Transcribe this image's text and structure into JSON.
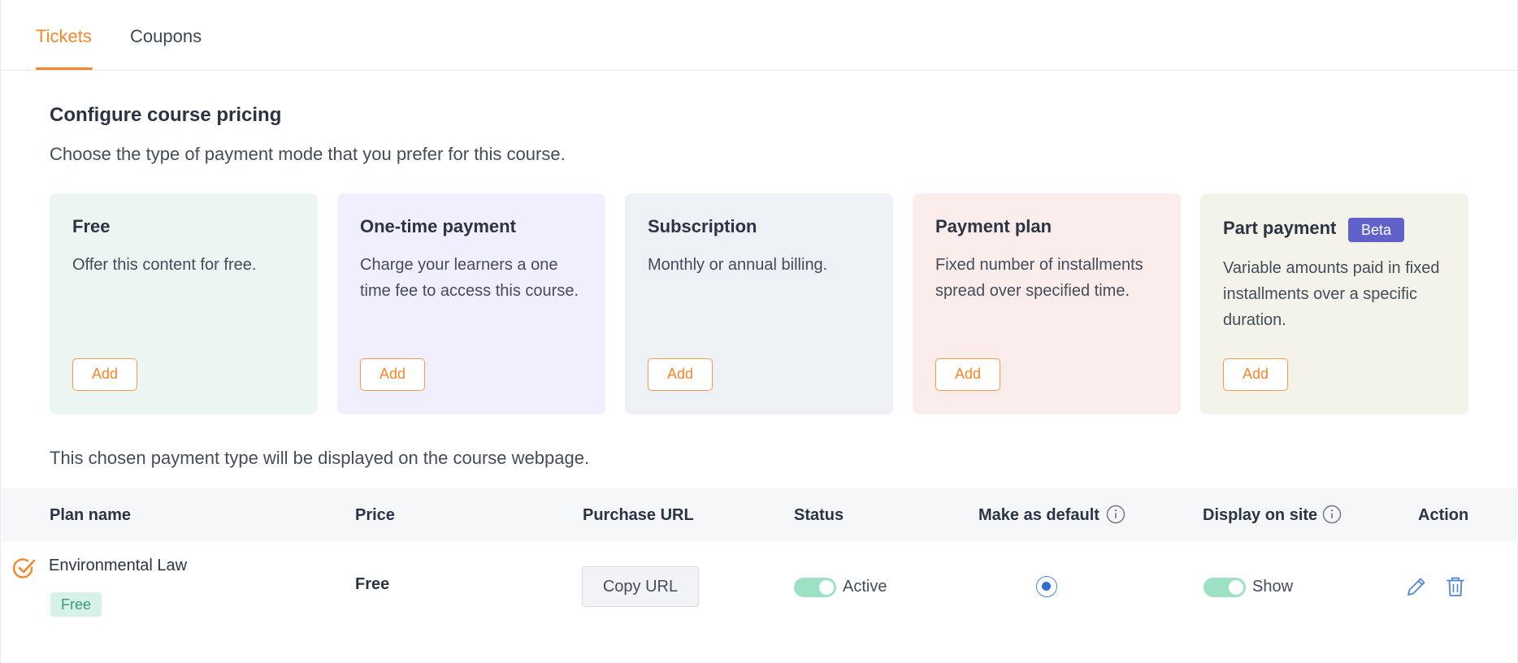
{
  "tabs": [
    {
      "label": "Tickets",
      "active": true
    },
    {
      "label": "Coupons",
      "active": false
    }
  ],
  "pricing": {
    "title": "Configure course pricing",
    "subtitle": "Choose the type of payment mode that you prefer for this course.",
    "cards": [
      {
        "title": "Free",
        "description": "Offer this content for free.",
        "button": "Add",
        "bg": "#ebf6f2"
      },
      {
        "title": "One-time payment",
        "description": "Charge your learners a one time fee to access this course.",
        "button": "Add",
        "bg": "#f1eefd"
      },
      {
        "title": "Subscription",
        "description": "Monthly or annual billing.",
        "button": "Add",
        "bg": "#edf0f5"
      },
      {
        "title": "Payment plan",
        "description": "Fixed number of installments spread over specified time.",
        "button": "Add",
        "bg": "#faecea"
      },
      {
        "title": "Part payment",
        "badge": "Beta",
        "description": "Variable amounts paid in fixed installments over a specific duration.",
        "button": "Add",
        "bg": "#f4f3ea"
      }
    ],
    "note": "This chosen payment type will be displayed on the course webpage."
  },
  "table": {
    "headers": {
      "plan_name": "Plan name",
      "price": "Price",
      "purchase_url": "Purchase URL",
      "status": "Status",
      "make_default": "Make as default",
      "display_on_site": "Display on site",
      "action": "Action"
    },
    "rows": [
      {
        "plan_name": "Environmental Law",
        "badge": "Free",
        "price": "Free",
        "copy_button": "Copy URL",
        "status": "Active",
        "status_on": true,
        "is_default": true,
        "display": "Show",
        "display_on": true
      }
    ]
  },
  "colors": {
    "accent": "#f5862b",
    "beta_badge": "#6062c9",
    "toggle_on": "#9de1c5",
    "radio": "#2f6fd0"
  }
}
